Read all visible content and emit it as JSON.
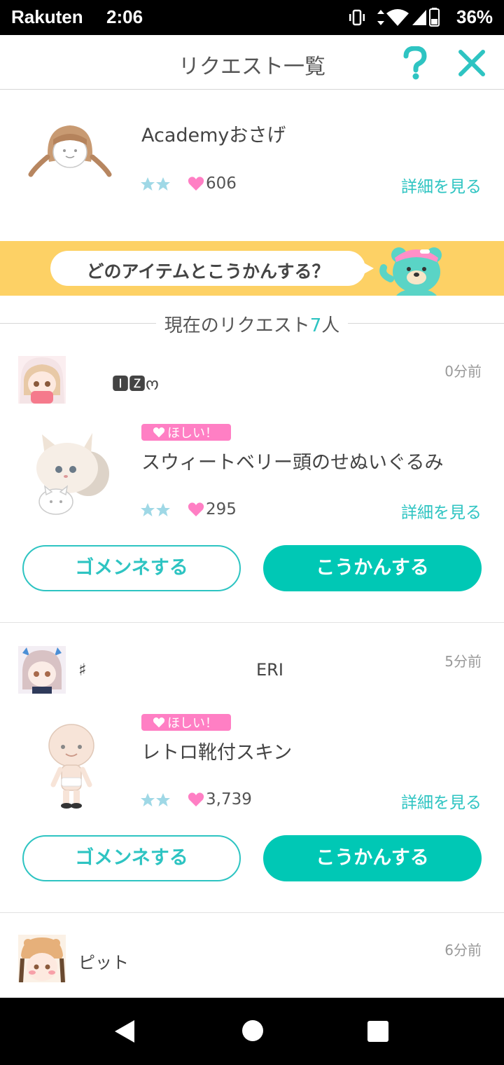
{
  "status_bar": {
    "carrier": "Rakuten",
    "time": "2:06",
    "battery": "36%",
    "icons": [
      "vibrate-icon",
      "data-arrows-icon",
      "wifi-icon",
      "signal-icon",
      "battery-icon"
    ]
  },
  "header": {
    "title": "リクエスト一覧",
    "help_icon": "question-icon",
    "close_icon": "close-icon"
  },
  "my_item": {
    "name": "Academyおさげ",
    "rarity_stars": 2,
    "likes": "606",
    "detail_link": "詳細を見る"
  },
  "banner": {
    "text": "どのアイテムとこうかんする？"
  },
  "section": {
    "title_prefix": "現在のリクエスト",
    "count": "7",
    "title_suffix": "人"
  },
  "requests": [
    {
      "username": "🅸🆉ო",
      "ago": "0分前",
      "badge": "ほしい！",
      "item_name": "スウィートベリー頭のせぬいぐるみ",
      "likes": "295",
      "detail_link": "詳細を見る",
      "decline_label": "ゴメンネする",
      "exchange_label": "こうかんする"
    },
    {
      "username_left": "♯",
      "username_right": "ERI",
      "ago": "5分前",
      "badge": "ほしい！",
      "item_name": "レトロ靴付スキン",
      "likes": "3,739",
      "detail_link": "詳細を見る",
      "decline_label": "ゴメンネする",
      "exchange_label": "こうかんする"
    },
    {
      "username": "ピット",
      "ago": "6分前"
    }
  ],
  "colors": {
    "accent": "#00c8b5",
    "accent_text": "#2ec4c2",
    "banner": "#fdd165",
    "badge": "#ff7fc4",
    "heart": "#ff7fc4"
  }
}
